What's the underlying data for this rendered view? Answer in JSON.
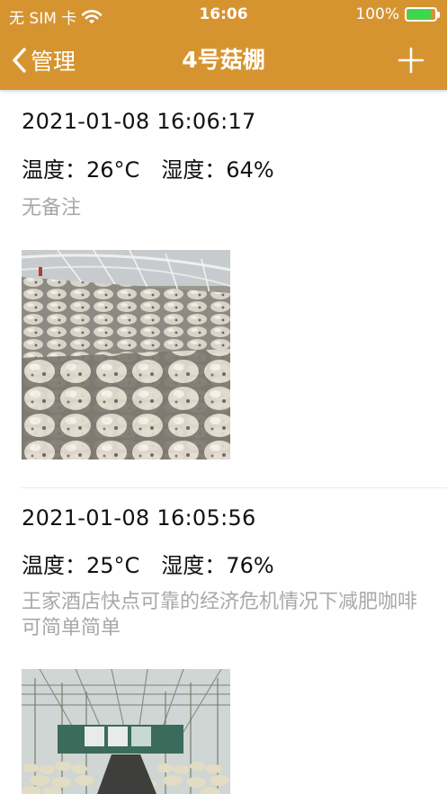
{
  "status_bar": {
    "carrier": "无 SIM 卡",
    "wifi_icon": "wifi-icon",
    "time": "16:06",
    "battery_percent": "100%",
    "battery_level": 1.0
  },
  "navbar": {
    "back_label": "管理",
    "title": "4号菇棚",
    "back_icon": "chevron-left-icon",
    "add_icon": "plus-icon"
  },
  "records": [
    {
      "datetime": "2021-01-08 16:06:17",
      "climate": "温度：26°C　湿度：64%",
      "note": "无备注",
      "photo": "mushroom-log-rows-in-greenhouse"
    },
    {
      "datetime": "2021-01-08 16:05:56",
      "climate": "温度：25°C　湿度：76%",
      "note": "王家酒店快点可靠的经济危机情况下减肥咖啡可简单简单",
      "photo": "mushroom-shelving-in-greenhouse"
    }
  ],
  "colors": {
    "brand": "#d69431",
    "note_text": "#a8a8a8",
    "battery": "#3ad84a"
  }
}
